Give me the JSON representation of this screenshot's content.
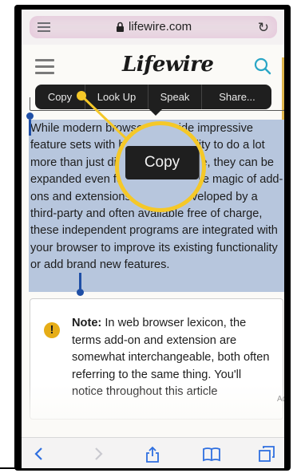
{
  "browser": {
    "url": "lifewire.com",
    "reload_icon": "reload-icon",
    "reader_icon": "reader-view-icon",
    "lock_icon": "lock-icon"
  },
  "site": {
    "logo": "Lifewire",
    "menu_icon": "hamburger-icon",
    "search_icon": "search-icon"
  },
  "edit_menu": {
    "items": [
      "Copy",
      "Look Up",
      "Speak",
      "Share..."
    ]
  },
  "article": {
    "paragraph": "While modern browsers provide impressive feature sets with basic functionality to do a lot more than just display a web page, they can be expanded even further through the magic of add-ons and extensions. Usually developed by a third-party and often available free of charge, these independent programs are integrated with your browser to improve its existing functionality or add brand new features."
  },
  "magnifier": {
    "copy_label": "Copy"
  },
  "note": {
    "label": "Note:",
    "text": "In web browser lexicon, the terms add-on and extension are somewhat interchangeable, both often referring to the same thing. You'll notice throughout this article"
  },
  "ad_label": "Ad",
  "toolbar": {
    "icons": [
      "back-icon",
      "forward-icon",
      "share-icon",
      "bookmarks-icon",
      "tabs-icon"
    ]
  },
  "colors": {
    "selection": "#b7c6dd",
    "callout": "#f5c828",
    "handle": "#1f4fa6",
    "menu_bg": "#1f1f1f",
    "toolbar_icon": "#2f6fe0"
  }
}
